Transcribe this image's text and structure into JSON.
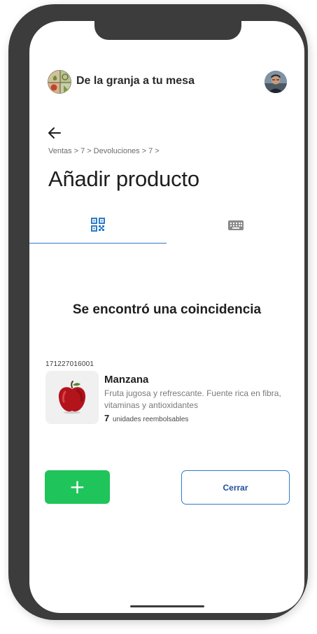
{
  "header": {
    "app_title": "De la granja a tu mesa",
    "logo_icon": "farm-produce-logo",
    "avatar_icon": "user-avatar"
  },
  "navigation": {
    "back_icon": "arrow-left-icon",
    "breadcrumb": [
      "Ventas",
      "7",
      "Devoluciones",
      "7"
    ],
    "separator": ">"
  },
  "page": {
    "title": "Añadir producto"
  },
  "tabs": [
    {
      "icon": "qr-code-icon",
      "active": true
    },
    {
      "icon": "keyboard-icon",
      "active": false
    }
  ],
  "result": {
    "heading": "Se encontró una coincidencia",
    "product": {
      "code": "171227016001",
      "name": "Manzana",
      "description": "Fruta jugosa y refrescante. Fuente rica en fibra, vitaminas y antioxidantes",
      "refundable_qty": "7",
      "refundable_label": "unidades reembolsables",
      "image_icon": "red-apple-image"
    }
  },
  "actions": {
    "add_label": "+",
    "close_label": "Cerrar"
  },
  "colors": {
    "accent_blue": "#2e7bc8",
    "add_green": "#1fc45a",
    "frame": "#3c3c3c"
  }
}
